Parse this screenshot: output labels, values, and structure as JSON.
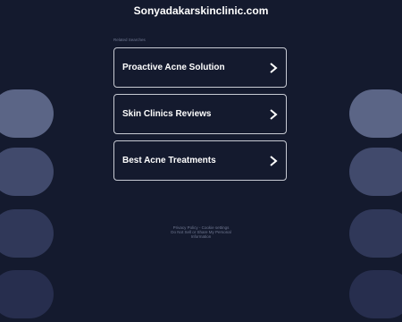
{
  "site": {
    "title": "Sonyadakarskinclinic.com"
  },
  "related": {
    "label": "Related Searches",
    "items": [
      {
        "label": "Proactive Acne Solution"
      },
      {
        "label": "Skin Clinics Reviews"
      },
      {
        "label": "Best Acne Treatments"
      }
    ]
  },
  "footer": {
    "privacy": "Privacy Policy",
    "separator": " - ",
    "cookie": "Cookie settings",
    "do_not_sell_line1": "Do Not Sell or Share My Personal",
    "do_not_sell_line2": "Information"
  },
  "colors": {
    "background": "#141a2e",
    "pill_1": "#5b6586",
    "pill_2": "#414a6c",
    "pill_3": "#303859",
    "pill_4": "#272e4e"
  }
}
